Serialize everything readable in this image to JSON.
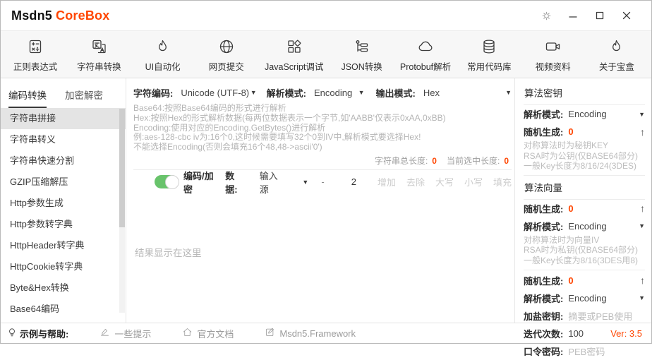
{
  "window": {
    "title_primary": "Msdn5",
    "title_accent": "CoreBox"
  },
  "colors": {
    "accent": "#ff4500",
    "toggle_on": "#68c36b",
    "selected_bg": "#e4e4e4",
    "toolbar_bg": "#f7f7f7",
    "hint_gray": "#b5b5b5"
  },
  "icons": {
    "dropdown": "▼",
    "up": "↑"
  },
  "toolbar": {
    "items": [
      {
        "icon": "regex-icon",
        "label": "正则表达式"
      },
      {
        "icon": "string-convert-icon",
        "label": "字符串转换"
      },
      {
        "icon": "flame-icon",
        "label": "UI自动化"
      },
      {
        "icon": "globe-icon",
        "label": "网页提交"
      },
      {
        "icon": "blocks-icon",
        "label": "JavaScript调试"
      },
      {
        "icon": "tree-icon",
        "label": "JSON转换"
      },
      {
        "icon": "cloud-icon",
        "label": "Protobuf解析"
      },
      {
        "icon": "database-icon",
        "label": "常用代码库"
      },
      {
        "icon": "video-icon",
        "label": "视频资料"
      },
      {
        "icon": "flame-icon",
        "label": "关于宝盒"
      }
    ]
  },
  "sidebar": {
    "tabs": [
      {
        "label": "编码转换",
        "active": true
      },
      {
        "label": "加密解密",
        "active": false
      }
    ],
    "selected_index": 0,
    "items": [
      "字符串拼接",
      "字符串转义",
      "字符串快速分割",
      "GZIP压缩解压",
      "Http参数生成",
      "Http参数转字典",
      "HttpHeader转字典",
      "HttpCookie转字典",
      "Byte&Hex转换",
      "Base64编码"
    ]
  },
  "content": {
    "encoding_row": {
      "charset_label": "字符编码:",
      "charset_value": "Unicode (UTF-8)",
      "parse_label": "解析模式:",
      "parse_value": "Encoding",
      "output_label": "输出模式:",
      "output_value": "Hex"
    },
    "hints": [
      "Base64:按照Base64编码的形式进行解析",
      "Hex:按照Hex的形式解析数据(每两位数据表示一个字节,如'AABB'仅表示0xAA,0xBB)",
      "Encoding:使用对应的Encoding.GetBytes()进行解析",
      "例:aes-128-cbc  iv为:16个0,这时候需要填写32个0到IV中,解析模式要选择Hex!",
      "不能选择Encoding(否则会填充16个48,48->ascii'0')"
    ],
    "stats": {
      "total_label": "字符串总长度:",
      "total_value": "0",
      "selected_label": "当前选中长度:",
      "selected_value": "0"
    },
    "action_row": {
      "toggle_label": "编码/加密",
      "data_label": "数据:",
      "source_value": "输入源",
      "separator": "-",
      "count_value": "2",
      "buttons": [
        "增加",
        "去除",
        "大写",
        "小写",
        "填充"
      ]
    },
    "result_placeholder": "结果显示在这里"
  },
  "key_panel": {
    "section1": {
      "title": "算法密钥",
      "parse_label": "解析模式:",
      "parse_value": "Encoding",
      "random_label": "随机生成:",
      "random_value": "0",
      "hints": [
        "对称算法时为秘钥KEY",
        "RSA时为公钥(仅BASE64部分)",
        "一般Key长度为8/16/24(3DES)"
      ]
    },
    "section2": {
      "title": "算法向量",
      "random_label": "随机生成:",
      "random_value": "0",
      "parse_label": "解析模式:",
      "parse_value": "Encoding",
      "hints": [
        "对称算法时为向量IV",
        "RSA时为私钥(仅BASE64部分)",
        "一般Key长度为8/16(3DES用8)"
      ]
    },
    "section3": {
      "random_label": "随机生成:",
      "random_value": "0",
      "parse_label": "解析模式:",
      "parse_value": "Encoding",
      "salt_label": "加盐密钥:",
      "salt_placeholder": "摘要或PEB使用",
      "iter_label": "迭代次数:",
      "iter_value": "100",
      "pwd_label": "口令密码:",
      "pwd_placeholder": "PEB密码"
    }
  },
  "footer": {
    "help_label": "示例与帮助:",
    "links": [
      {
        "icon": "pen-sign-icon",
        "label": "一些提示"
      },
      {
        "icon": "home-icon",
        "label": "官方文档"
      },
      {
        "icon": "edit-icon",
        "label": "Msdn5.Framework"
      }
    ],
    "version": "Ver: 3.5"
  }
}
